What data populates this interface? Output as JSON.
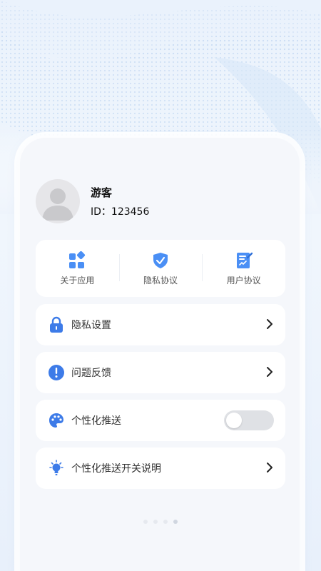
{
  "profile": {
    "username": "游客",
    "id_text": "ID：123456"
  },
  "quick_actions": [
    {
      "label": "关于应用",
      "icon": "grid-apps-icon"
    },
    {
      "label": "隐私协议",
      "icon": "shield-check-icon"
    },
    {
      "label": "用户协议",
      "icon": "document-sign-icon"
    }
  ],
  "settings": {
    "privacy": {
      "label": "隐私设置",
      "icon": "lock-icon"
    },
    "feedback": {
      "label": "问题反馈",
      "icon": "exclamation-icon"
    },
    "push": {
      "label": "个性化推送",
      "icon": "palette-icon",
      "enabled": false
    },
    "push_explain": {
      "label": "个性化推送开关说明",
      "icon": "lightbulb-icon"
    }
  },
  "pager": {
    "count": 4,
    "active_index": 3
  },
  "colors": {
    "accent": "#4a8ff5",
    "lock": "#3d7be8"
  }
}
